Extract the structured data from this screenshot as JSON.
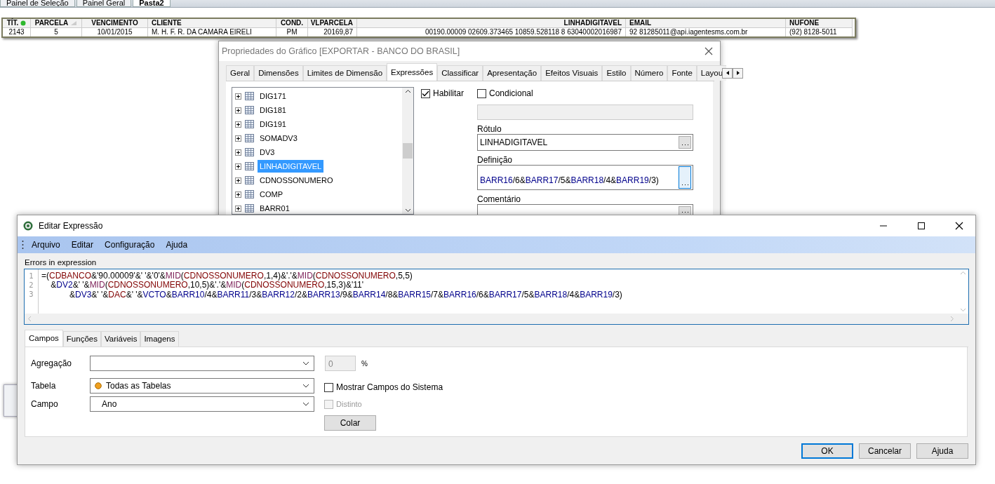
{
  "sheet_tabs": [
    {
      "label": "Painel de Seleção",
      "selected": false
    },
    {
      "label": "Painel Geral",
      "selected": false
    },
    {
      "label": "Pasta2",
      "selected": true
    }
  ],
  "table": {
    "columns": [
      {
        "label": "TÍT.",
        "status_dot": true,
        "sorted": false
      },
      {
        "label": "PARCELA",
        "sorted": true
      },
      {
        "label": "VENCIMENTO",
        "sorted": false
      },
      {
        "label": "CLIENTE",
        "sorted": false
      },
      {
        "label": "COND.",
        "sorted": false
      },
      {
        "label": "VLPARCELA",
        "sorted": false
      },
      {
        "label": "LINHADIGITAVEL",
        "sorted": false
      },
      {
        "label": "EMAIL",
        "sorted": false
      },
      {
        "label": "NUFONE",
        "sorted": false
      }
    ],
    "rows": [
      [
        "2143",
        "5",
        "10/01/2015",
        "M. H. F. R. DA CAMARA EIRELI",
        "PM",
        "20169,87",
        "00190.00009 02609.373465 10859.528118 8 63040002016987",
        "92 81285011@api.iagentesms.com.br",
        "(92) 8128-5011"
      ]
    ]
  },
  "properties_dialog": {
    "title": "Propriedades do Gráfico [EXPORTAR - BANCO DO BRASIL]",
    "tabs": [
      {
        "label": "Geral",
        "selected": false
      },
      {
        "label": "Dimensões",
        "selected": false
      },
      {
        "label": "Limites de Dimensão",
        "selected": false
      },
      {
        "label": "Expressões",
        "selected": true
      },
      {
        "label": "Classificar",
        "selected": false
      },
      {
        "label": "Apresentação",
        "selected": false
      },
      {
        "label": "Efeitos Visuais",
        "selected": false
      },
      {
        "label": "Estilo",
        "selected": false
      },
      {
        "label": "Número",
        "selected": false
      },
      {
        "label": "Fonte",
        "selected": false
      },
      {
        "label": "Layou",
        "selected": false
      }
    ],
    "expressions": [
      {
        "label": "DIG171",
        "selected": false
      },
      {
        "label": "DIG181",
        "selected": false
      },
      {
        "label": "DIG191",
        "selected": false
      },
      {
        "label": "SOMADV3",
        "selected": false
      },
      {
        "label": "DV3",
        "selected": false
      },
      {
        "label": "LINHADIGITAVEL",
        "selected": true
      },
      {
        "label": "CDNOSSONUMERO",
        "selected": false
      },
      {
        "label": "COMP",
        "selected": false
      },
      {
        "label": "BARR01",
        "selected": false
      }
    ],
    "enable": {
      "label": "Habilitar",
      "checked": true
    },
    "conditional": {
      "label": "Condicional",
      "checked": false
    },
    "label_field": {
      "label": "Rótulo",
      "value": "LINHADIGITAVEL"
    },
    "definition": {
      "label": "Definição",
      "tokens": [
        {
          "kind": "variable",
          "text": "BARR16"
        },
        {
          "kind": "plain",
          "text": "/6&"
        },
        {
          "kind": "variable",
          "text": "BARR17"
        },
        {
          "kind": "plain",
          "text": "/5&"
        },
        {
          "kind": "variable",
          "text": "BARR18"
        },
        {
          "kind": "plain",
          "text": "/4&"
        },
        {
          "kind": "variable",
          "text": "BARR19"
        },
        {
          "kind": "plain",
          "text": "/3)"
        }
      ]
    },
    "comment": {
      "label": "Comentário"
    }
  },
  "editor": {
    "title": "Editar Expressão",
    "menu": [
      "Arquivo",
      "Editar",
      "Configuração",
      "Ajuda"
    ],
    "status": "Errors in expression",
    "lines": [
      {
        "number": "1",
        "tokens": [
          {
            "kind": "plain",
            "text": "=("
          },
          {
            "kind": "field",
            "text": "CDBANCO"
          },
          {
            "kind": "plain",
            "text": "&'90.00009'&' '&'0'&"
          },
          {
            "kind": "function",
            "text": "MID"
          },
          {
            "kind": "plain",
            "text": "("
          },
          {
            "kind": "field",
            "text": "CDNOSSONUMERO"
          },
          {
            "kind": "plain",
            "text": ",1,4)&'.'&"
          },
          {
            "kind": "function",
            "text": "MID"
          },
          {
            "kind": "plain",
            "text": "("
          },
          {
            "kind": "field",
            "text": "CDNOSSONUMERO"
          },
          {
            "kind": "plain",
            "text": ",5,5)"
          }
        ]
      },
      {
        "number": "2",
        "tokens": [
          {
            "kind": "plain",
            "text": "    &"
          },
          {
            "kind": "variable",
            "text": "DV2"
          },
          {
            "kind": "plain",
            "text": "&' '&"
          },
          {
            "kind": "function",
            "text": "MID"
          },
          {
            "kind": "plain",
            "text": "("
          },
          {
            "kind": "field",
            "text": "CDNOSSONUMERO"
          },
          {
            "kind": "plain",
            "text": ",10,5)&'.'&"
          },
          {
            "kind": "function",
            "text": "MID"
          },
          {
            "kind": "plain",
            "text": "("
          },
          {
            "kind": "field",
            "text": "CDNOSSONUMERO"
          },
          {
            "kind": "plain",
            "text": ",15,3)&'11'"
          }
        ]
      },
      {
        "number": "3",
        "tokens": [
          {
            "kind": "plain",
            "text": "            &"
          },
          {
            "kind": "variable",
            "text": "DV3"
          },
          {
            "kind": "plain",
            "text": "&' '&"
          },
          {
            "kind": "field",
            "text": "DAC"
          },
          {
            "kind": "plain",
            "text": "&' '&"
          },
          {
            "kind": "variable",
            "text": "VCTO"
          },
          {
            "kind": "plain",
            "text": "&"
          },
          {
            "kind": "variable",
            "text": "BARR10"
          },
          {
            "kind": "plain",
            "text": "/4&"
          },
          {
            "kind": "variable",
            "text": "BARR11"
          },
          {
            "kind": "plain",
            "text": "/3&"
          },
          {
            "kind": "variable",
            "text": "BARR12"
          },
          {
            "kind": "plain",
            "text": "/2&"
          },
          {
            "kind": "variable",
            "text": "BARR13"
          },
          {
            "kind": "plain",
            "text": "/9&"
          },
          {
            "kind": "variable",
            "text": "BARR14"
          },
          {
            "kind": "plain",
            "text": "/8&"
          },
          {
            "kind": "variable",
            "text": "BARR15"
          },
          {
            "kind": "plain",
            "text": "/7&"
          },
          {
            "kind": "variable",
            "text": "BARR16"
          },
          {
            "kind": "plain",
            "text": "/6&"
          },
          {
            "kind": "variable",
            "text": "BARR17"
          },
          {
            "kind": "plain",
            "text": "/5&"
          },
          {
            "kind": "variable",
            "text": "BARR18"
          },
          {
            "kind": "plain",
            "text": "/4&"
          },
          {
            "kind": "variable",
            "text": "BARR19"
          },
          {
            "kind": "plain",
            "text": "/3)"
          }
        ]
      }
    ],
    "tabs": [
      {
        "label": "Campos",
        "selected": true
      },
      {
        "label": "Funções",
        "selected": false
      },
      {
        "label": "Variáveis",
        "selected": false
      },
      {
        "label": "Imagens",
        "selected": false
      }
    ],
    "aggregation": {
      "label": "Agregação",
      "percent_value": "0",
      "percent_sign": "%"
    },
    "table_select": {
      "label": "Tabela",
      "value": "Todas as Tabelas"
    },
    "field_select": {
      "label": "Campo",
      "value": "Ano"
    },
    "show_system_fields": {
      "label": "Mostrar Campos do Sistema",
      "checked": false,
      "disabled": false
    },
    "distinct": {
      "label": "Distinto",
      "checked": false,
      "disabled": true
    },
    "paste_button": "Colar",
    "buttons": [
      {
        "label": "OK",
        "default": true
      },
      {
        "label": "Cancelar",
        "default": false
      },
      {
        "label": "Ajuda",
        "default": false
      }
    ]
  }
}
